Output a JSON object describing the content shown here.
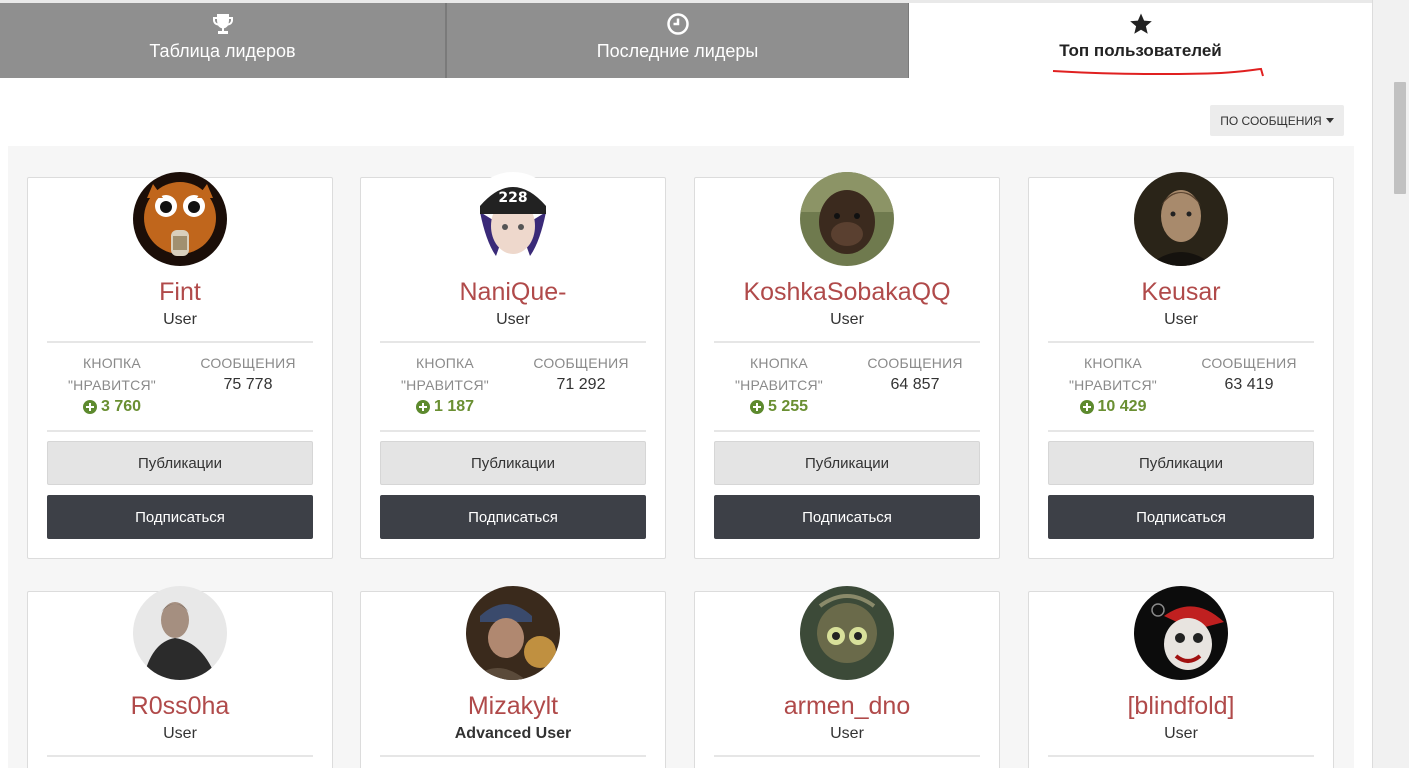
{
  "tabs": [
    {
      "label": "Таблица лидеров",
      "icon": "trophy-icon"
    },
    {
      "label": "Последние лидеры",
      "icon": "clock-icon"
    },
    {
      "label": "Топ пользователей",
      "icon": "star-icon",
      "active": true
    }
  ],
  "sort": {
    "label": "ПО СООБЩЕНИЯ"
  },
  "labels": {
    "likes_line1": "КНОПКА",
    "likes_line2": "\"НРАВИТСЯ\"",
    "posts": "СООБЩЕНИЯ",
    "publications": "Публикации",
    "subscribe": "Подписаться"
  },
  "users": [
    {
      "name": "Fint",
      "role": "User",
      "likes": "3 760",
      "posts": "75 778"
    },
    {
      "name": "NaniQue-",
      "role": "User",
      "likes": "1 187",
      "posts": "71 292"
    },
    {
      "name": "KoshkaSobakaQQ",
      "role": "User",
      "likes": "5 255",
      "posts": "64 857"
    },
    {
      "name": "Keusar",
      "role": "User",
      "likes": "10 429",
      "posts": "63 419"
    },
    {
      "name": "R0ss0ha",
      "role": "User"
    },
    {
      "name": "Mizakylt",
      "role": "Advanced User"
    },
    {
      "name": "armen_dno",
      "role": "User"
    },
    {
      "name": "[blindfold]",
      "role": "User"
    }
  ],
  "colors": {
    "username": "#b04a4a",
    "likes": "#6a8f32",
    "tab_inactive": "#8f8f8f",
    "subscribe_btn": "#3d4047"
  }
}
